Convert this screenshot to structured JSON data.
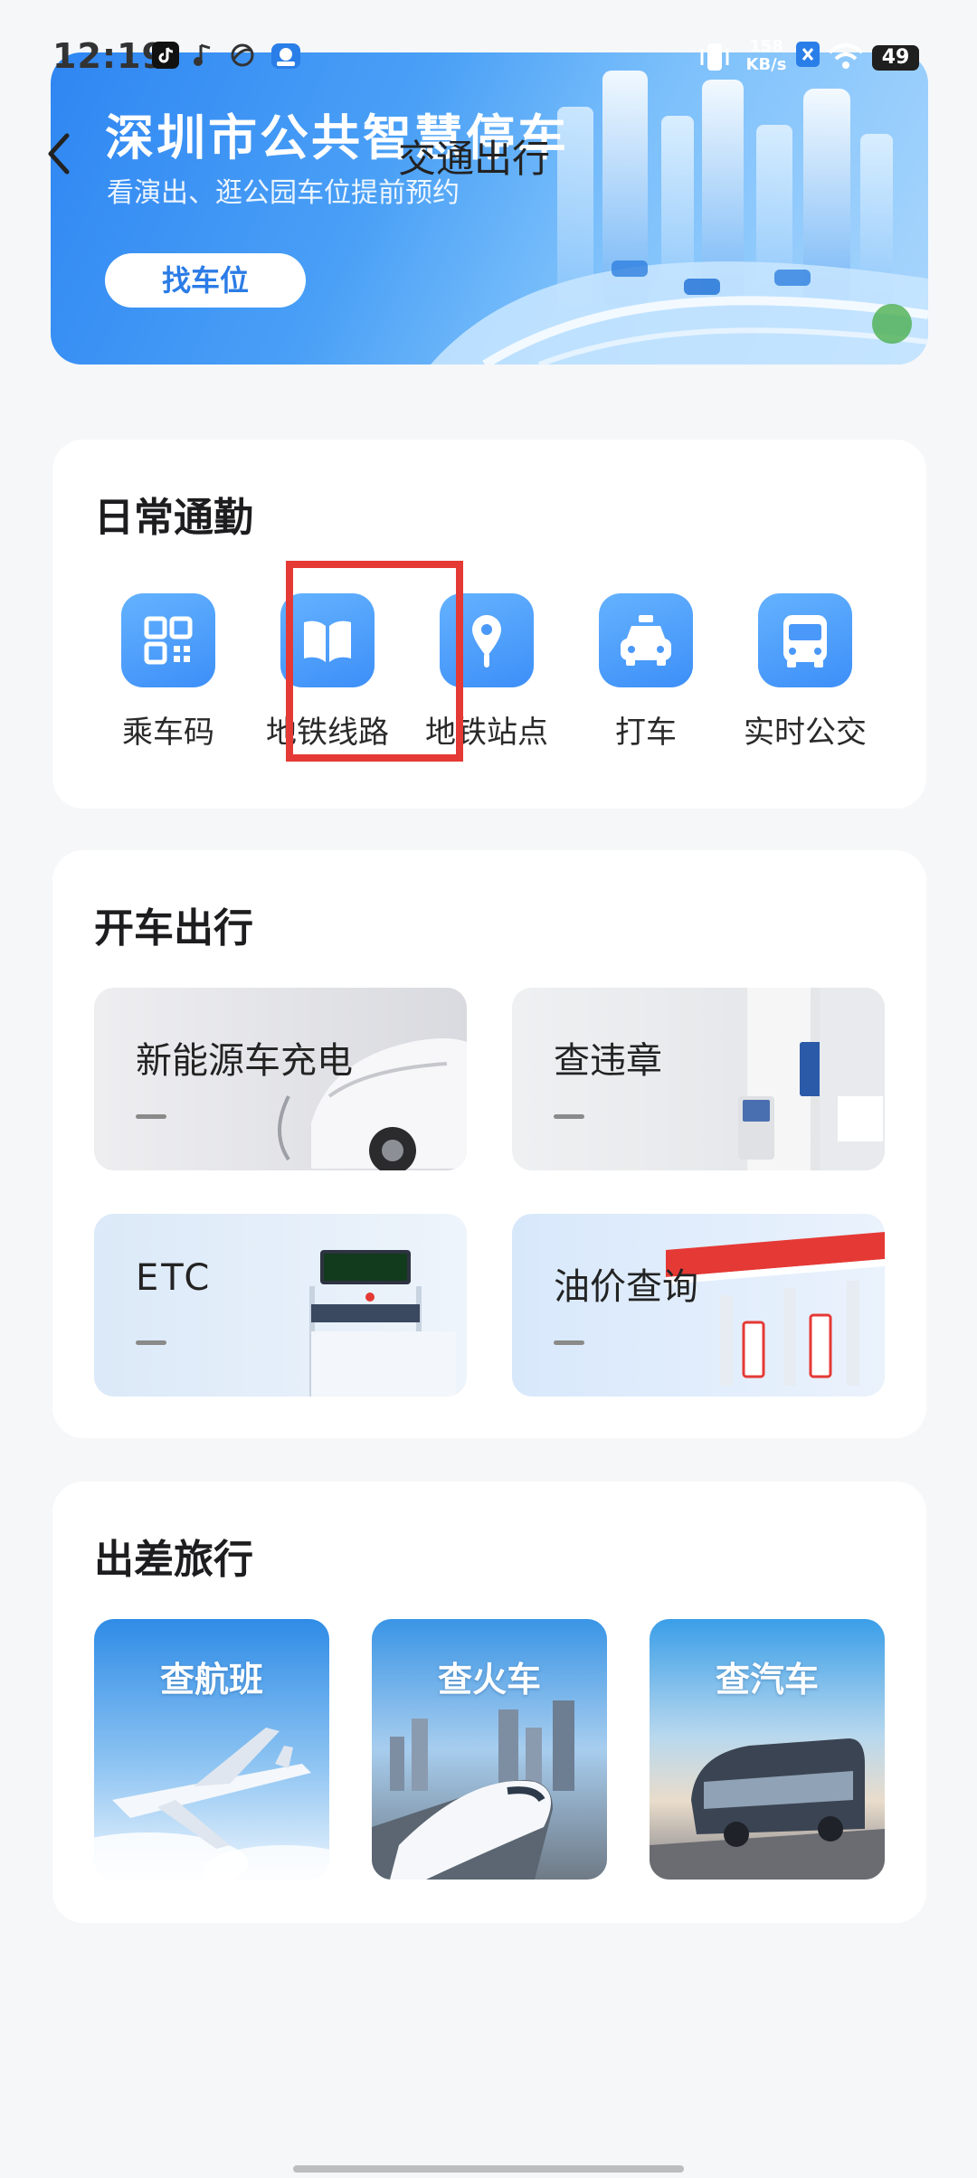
{
  "status_bar": {
    "time": "12:19",
    "net_speed_value": "158",
    "net_speed_unit": "KB/s",
    "battery": "49",
    "icons": [
      "tiktok-icon",
      "music-note-icon",
      "browser-icon",
      "app-badge-icon",
      "vibrate-icon",
      "close-badge-icon",
      "wifi-icon",
      "battery-icon"
    ]
  },
  "nav": {
    "back_icon": "chevron-left-icon",
    "title": "交通出行"
  },
  "banner": {
    "title": "深圳市公共智慧停车",
    "subtitle": "看演出、逛公园车位提前预约",
    "button": "找车位"
  },
  "commute": {
    "title": "日常通勤",
    "items": [
      {
        "label": "乘车码",
        "icon": "qr-code-icon"
      },
      {
        "label": "地铁线路",
        "icon": "book-icon"
      },
      {
        "label": "地铁站点",
        "icon": "map-pin-icon"
      },
      {
        "label": "打车",
        "icon": "taxi-icon"
      },
      {
        "label": "实时公交",
        "icon": "bus-icon"
      }
    ]
  },
  "driving": {
    "title": "开车出行",
    "items": [
      {
        "label": "新能源车充电"
      },
      {
        "label": "查违章"
      },
      {
        "label": "ETC"
      },
      {
        "label": "油价查询"
      }
    ]
  },
  "travel": {
    "title": "出差旅行",
    "items": [
      {
        "label": "查航班"
      },
      {
        "label": "查火车"
      },
      {
        "label": "查汽车"
      }
    ]
  },
  "colors": {
    "accent": "#3d8ff8",
    "page_bg": "#f6f7f9",
    "highlight": "#e53935"
  }
}
